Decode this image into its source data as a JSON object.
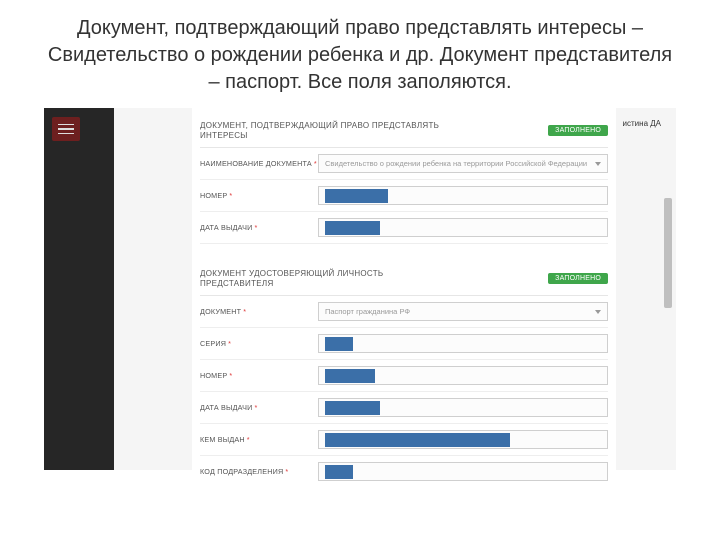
{
  "title": "Документ, подтверждающий право представлять интересы – Свидетельство о рождении ребенка и др. Документ представителя – паспорт. Все поля заполяются.",
  "userName": "истина ДА",
  "section1": {
    "heading": "ДОКУМЕНТ, ПОДТВЕРЖДАЮЩИЙ ПРАВО ПРЕДСТАВЛЯТЬ ИНТЕРЕСЫ",
    "badge": "ЗАПОЛНЕНО",
    "fields": {
      "docName": {
        "label": "НАИМЕНОВАНИЕ ДОКУМЕНТА",
        "placeholder": "Свидетельство о рождении ребенка на территории Российской Федерации"
      },
      "number": {
        "label": "НОМЕР"
      },
      "issueDate": {
        "label": "ДАТА ВЫДАЧИ"
      }
    }
  },
  "section2": {
    "heading": "ДОКУМЕНТ УДОСТОВЕРЯЮЩИЙ ЛИЧНОСТЬ ПРЕДСТАВИТЕЛЯ",
    "badge": "ЗАПОЛНЕНО",
    "fields": {
      "doc": {
        "label": "ДОКУМЕНТ",
        "placeholder": "Паспорт гражданина РФ"
      },
      "series": {
        "label": "СЕРИЯ"
      },
      "number": {
        "label": "НОМЕР"
      },
      "issueDate": {
        "label": "ДАТА ВЫДАЧИ"
      },
      "issuedBy": {
        "label": "КЕМ ВЫДАН"
      },
      "divCode": {
        "label": "КОД ПОДРАЗДЕЛЕНИЯ"
      }
    }
  }
}
